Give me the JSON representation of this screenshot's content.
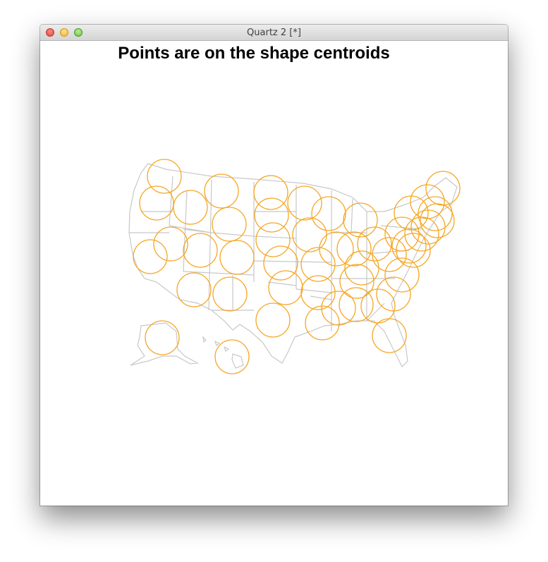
{
  "window": {
    "title": "Quartz 2 [*]"
  },
  "plot": {
    "title": "Points are on the shape centroids"
  },
  "colors": {
    "circle_stroke": "#f5a623",
    "map_stroke": "#c8c8c8"
  }
}
